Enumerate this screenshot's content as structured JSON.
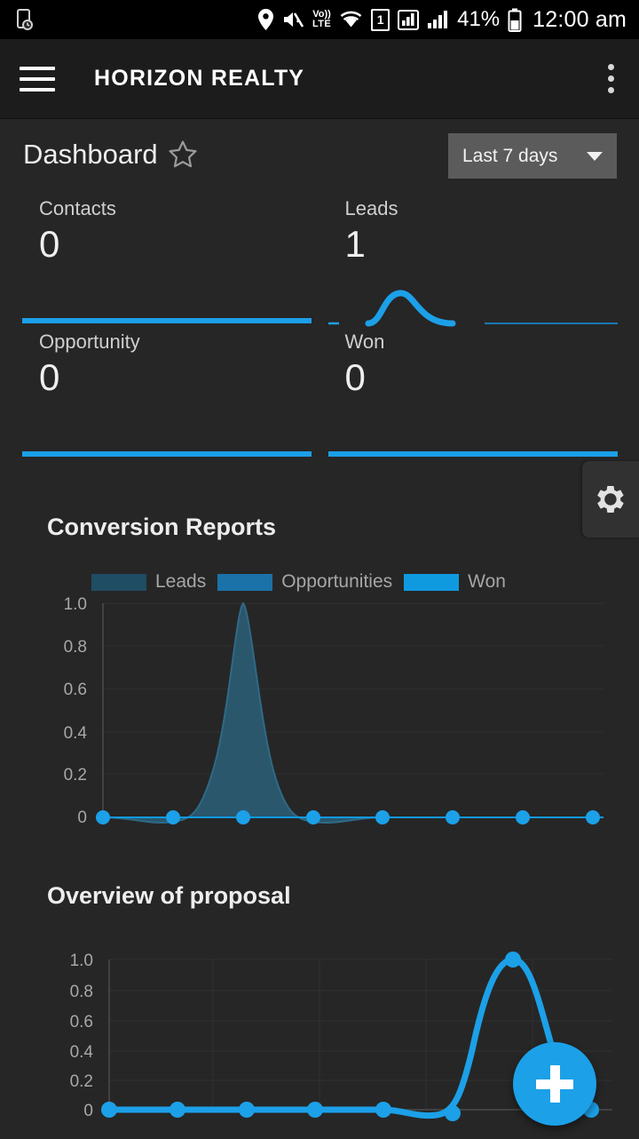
{
  "status_bar": {
    "time": "12:00 am",
    "battery_percent": "41%",
    "sim_label": "1",
    "volte_top": "Vo))",
    "volte_bottom": "LTE",
    "icons": [
      "clock-alarm-icon",
      "location-icon",
      "mute-icon",
      "volte-icon",
      "wifi-icon",
      "sim-card-icon",
      "signal-icon-1",
      "signal-icon-2",
      "battery-icon"
    ]
  },
  "app_bar": {
    "title": "HORIZON REALTY",
    "menu_icon": "hamburger-icon",
    "overflow_icon": "overflow-menu-icon"
  },
  "dashboard": {
    "title": "Dashboard",
    "favorite_icon": "star-outline-icon",
    "date_range": {
      "selected": "Last 7 days",
      "caret_icon": "chevron-down-icon"
    },
    "metrics": [
      {
        "label": "Contacts",
        "value": "0"
      },
      {
        "label": "Leads",
        "value": "1"
      },
      {
        "label": "Opportunity",
        "value": "0"
      },
      {
        "label": "Won",
        "value": "0"
      }
    ],
    "settings_tab_icon": "gear-icon"
  },
  "sections": {
    "conversion_title": "Conversion Reports",
    "overview_title": "Overview of proposal"
  },
  "fab": {
    "label": "+",
    "icon": "plus-icon"
  },
  "colors": {
    "accent": "#1ca0e8",
    "leads": "#1f4d63",
    "opportunities": "#1a72a8",
    "won": "#0f9ae0",
    "background": "#262626",
    "appbar": "#1c1c1c",
    "axis_text": "#a8a8a8"
  },
  "chart_data": [
    {
      "type": "area",
      "title": "Conversion Reports",
      "xlabel": "",
      "ylabel": "",
      "ylim": [
        0,
        1.0
      ],
      "ytick_labels": [
        "1.0",
        "0.8",
        "0.6",
        "0.4",
        "0.2",
        "0"
      ],
      "yticks": [
        1.0,
        0.8,
        0.6,
        0.4,
        0.2,
        0
      ],
      "grid": true,
      "legend_position": "top",
      "x": [
        1,
        2,
        3,
        4,
        5,
        6,
        7,
        8
      ],
      "series": [
        {
          "name": "Leads",
          "color": "#1f4d63",
          "values": [
            0,
            0,
            1.0,
            0,
            0,
            0,
            0,
            0
          ]
        },
        {
          "name": "Opportunities",
          "color": "#1a72a8",
          "values": [
            0,
            0,
            0,
            0,
            0,
            0,
            0,
            0
          ]
        },
        {
          "name": "Won",
          "color": "#0f9ae0",
          "values": [
            0,
            0,
            0,
            0,
            0,
            0,
            0,
            0
          ]
        }
      ]
    },
    {
      "type": "line",
      "title": "Overview of proposal",
      "xlabel": "",
      "ylabel": "",
      "ylim": [
        0,
        1.0
      ],
      "ytick_labels": [
        "1.0",
        "0.8",
        "0.6",
        "0.4",
        "0.2",
        "0"
      ],
      "yticks": [
        1.0,
        0.8,
        0.6,
        0.4,
        0.2,
        0
      ],
      "grid": true,
      "legend_position": "none",
      "x": [
        1,
        2,
        3,
        4,
        5,
        6,
        7,
        8
      ],
      "series": [
        {
          "name": "Proposals",
          "color": "#1ca0e8",
          "values": [
            0,
            0,
            0,
            0,
            0,
            0,
            1.0,
            0
          ]
        }
      ]
    },
    {
      "type": "line",
      "title": "Leads sparkline",
      "ylim": [
        0,
        1.0
      ],
      "grid": false,
      "legend_position": "none",
      "x": [
        1,
        2,
        3,
        4,
        5,
        6,
        7
      ],
      "series": [
        {
          "name": "Leads",
          "color": "#1ca0e8",
          "values": [
            0,
            0,
            1.0,
            0,
            0,
            0,
            0
          ]
        }
      ]
    }
  ]
}
